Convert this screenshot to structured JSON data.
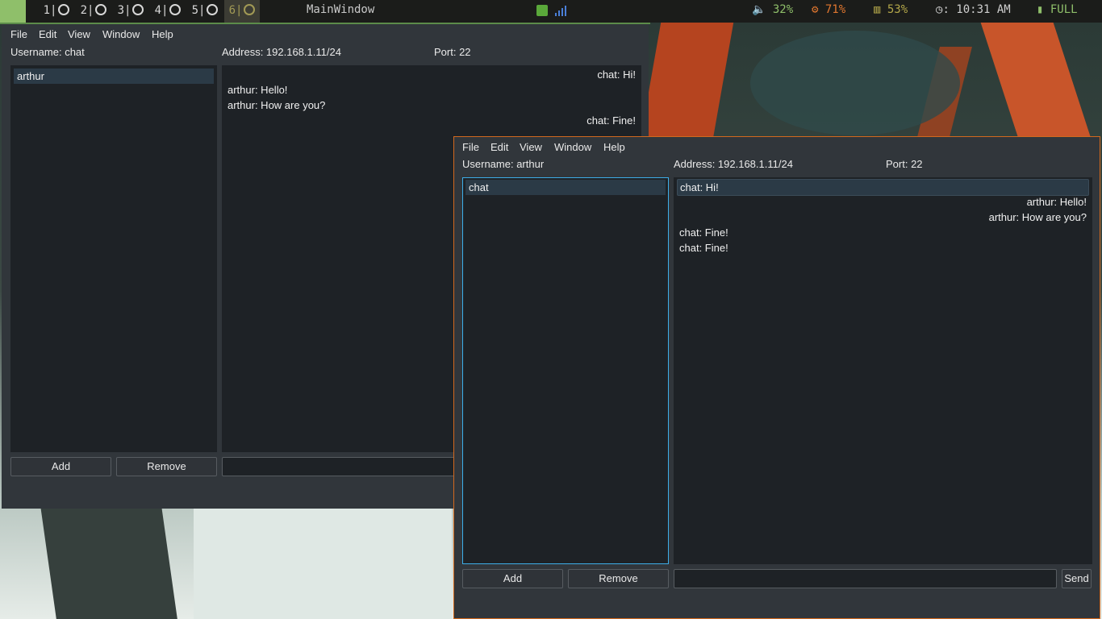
{
  "topbar": {
    "workspaces": [
      "1",
      "2",
      "3",
      "4",
      "5",
      "6"
    ],
    "active_workspace": "6",
    "window_title": "MainWindow",
    "volume": "32%",
    "cpu": "71%",
    "memory": "53%",
    "clock": ": 10:31 AM",
    "battery": "FULL",
    "icons": [
      "volume-icon",
      "cpu-icon",
      "memory-icon",
      "clock-icon",
      "battery-icon",
      "shield-tray-icon",
      "signal-tray-icon"
    ],
    "colors": {
      "volume": "#8fbf6a",
      "cpu": "#e0762f",
      "memory": "#b3a74a",
      "clock": "#cfcfcf",
      "battery": "#8fbf6a"
    }
  },
  "window_back": {
    "menu": [
      "File",
      "Edit",
      "View",
      "Window",
      "Help"
    ],
    "username": "Username: chat",
    "address": "Address: 192.168.1.11/24",
    "port": "Port: 22",
    "contacts": [
      "arthur"
    ],
    "messages": [
      {
        "text": "chat: Hi!",
        "align": "right"
      },
      {
        "text": "arthur: Hello!",
        "align": "left"
      },
      {
        "text": "arthur: How are you?",
        "align": "left"
      },
      {
        "text": "chat: Fine!",
        "align": "right"
      }
    ],
    "add_label": "Add",
    "remove_label": "Remove"
  },
  "window_front": {
    "menu": [
      "File",
      "Edit",
      "View",
      "Window",
      "Help"
    ],
    "username": "Username: arthur",
    "address": "Address: 192.168.1.11/24",
    "port": "Port: 22",
    "contacts": [
      "chat"
    ],
    "messages": [
      {
        "text": "chat: Hi!",
        "align": "left"
      },
      {
        "text": "arthur: Hello!",
        "align": "right"
      },
      {
        "text": "arthur: How are you?",
        "align": "right"
      },
      {
        "text": "chat: Fine!",
        "align": "left"
      },
      {
        "text": "chat: Fine!",
        "align": "left"
      }
    ],
    "add_label": "Add",
    "remove_label": "Remove",
    "send_label": "Send",
    "message_input_value": ""
  }
}
